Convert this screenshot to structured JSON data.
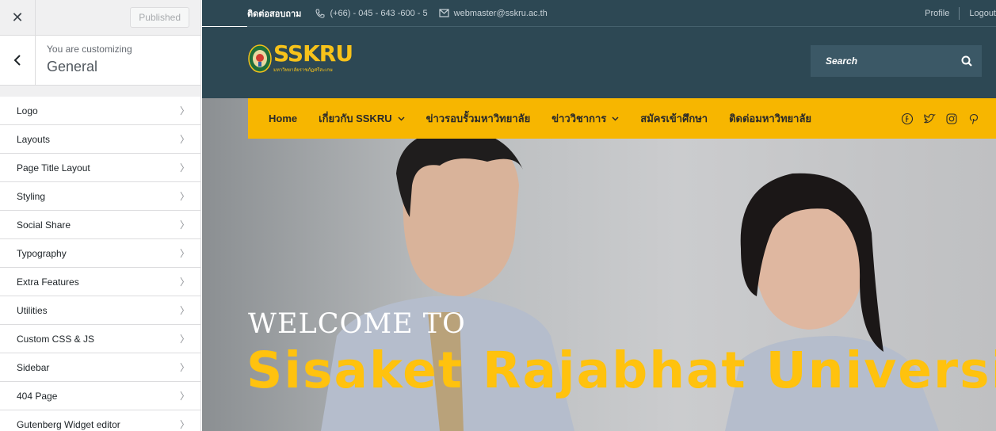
{
  "customizer": {
    "close_icon": "close-icon",
    "published_label": "Published",
    "customizing_label": "You are customizing",
    "section_title": "General",
    "items": [
      {
        "label": "Logo"
      },
      {
        "label": "Layouts"
      },
      {
        "label": "Page Title Layout"
      },
      {
        "label": "Styling"
      },
      {
        "label": "Social Share"
      },
      {
        "label": "Typography"
      },
      {
        "label": "Extra Features"
      },
      {
        "label": "Utilities"
      },
      {
        "label": "Custom CSS & JS"
      },
      {
        "label": "Sidebar"
      },
      {
        "label": "404 Page"
      },
      {
        "label": "Gutenberg Widget editor"
      }
    ]
  },
  "topbar": {
    "contact_label": "ติดต่อสอบถาม",
    "phone": "(+66) - 045 - 643 -600 - 5",
    "email": "webmaster@sskru.ac.th",
    "profile_label": "Profile",
    "logout_label": "Logout"
  },
  "header": {
    "logo_text": "SSKRU",
    "logo_subtext": "มหาวิทยาลัยราชภัฏศรีสะเกษ",
    "search_placeholder": "Search"
  },
  "nav": {
    "items": [
      {
        "label": "Home",
        "dropdown": false
      },
      {
        "label": "เกี่ยวกับ SSKRU",
        "dropdown": true
      },
      {
        "label": "ข่าวรอบรั้วมหาวิทยาลัย",
        "dropdown": false
      },
      {
        "label": "ข่าววิชาการ",
        "dropdown": true
      },
      {
        "label": "สมัครเข้าศึกษา",
        "dropdown": false
      },
      {
        "label": "ติดต่อมหาวิทยาลัย",
        "dropdown": false
      }
    ],
    "social_icons": [
      "facebook-icon",
      "twitter-icon",
      "instagram-icon",
      "pinterest-icon"
    ]
  },
  "hero": {
    "welcome": "WELCOME TO",
    "university": "Sisaket Rajabhat University"
  },
  "colors": {
    "header_bg": "#2d4854",
    "accent_yellow": "#f7b600",
    "title_yellow": "#ffc20e"
  }
}
